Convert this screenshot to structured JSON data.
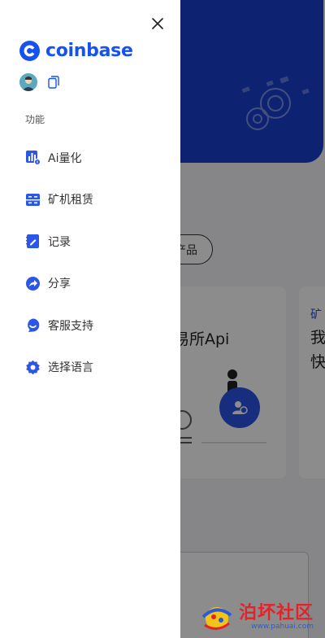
{
  "drawer": {
    "brand": "coinbase",
    "section_title": "功能",
    "items": [
      {
        "label": "Ai量化",
        "icon": "ai-quant-icon"
      },
      {
        "label": "矿机租赁",
        "icon": "mining-rental-icon"
      },
      {
        "label": "记录",
        "icon": "record-icon"
      },
      {
        "label": "分享",
        "icon": "share-icon"
      },
      {
        "label": "客服支持",
        "icon": "customer-service-icon"
      },
      {
        "label": "选择语言",
        "icon": "language-icon"
      }
    ]
  },
  "background": {
    "pill_label": "产品",
    "card1_title": "易所Api",
    "card2_tag": "矿",
    "card2_text": "我快"
  },
  "watermark": {
    "text": "泊坏社区",
    "url": "www.pahuai.com"
  },
  "colors": {
    "brand": "#1652f0",
    "hero": "#1b3fd0",
    "scrim": "rgba(0,0,0,0.45)"
  }
}
